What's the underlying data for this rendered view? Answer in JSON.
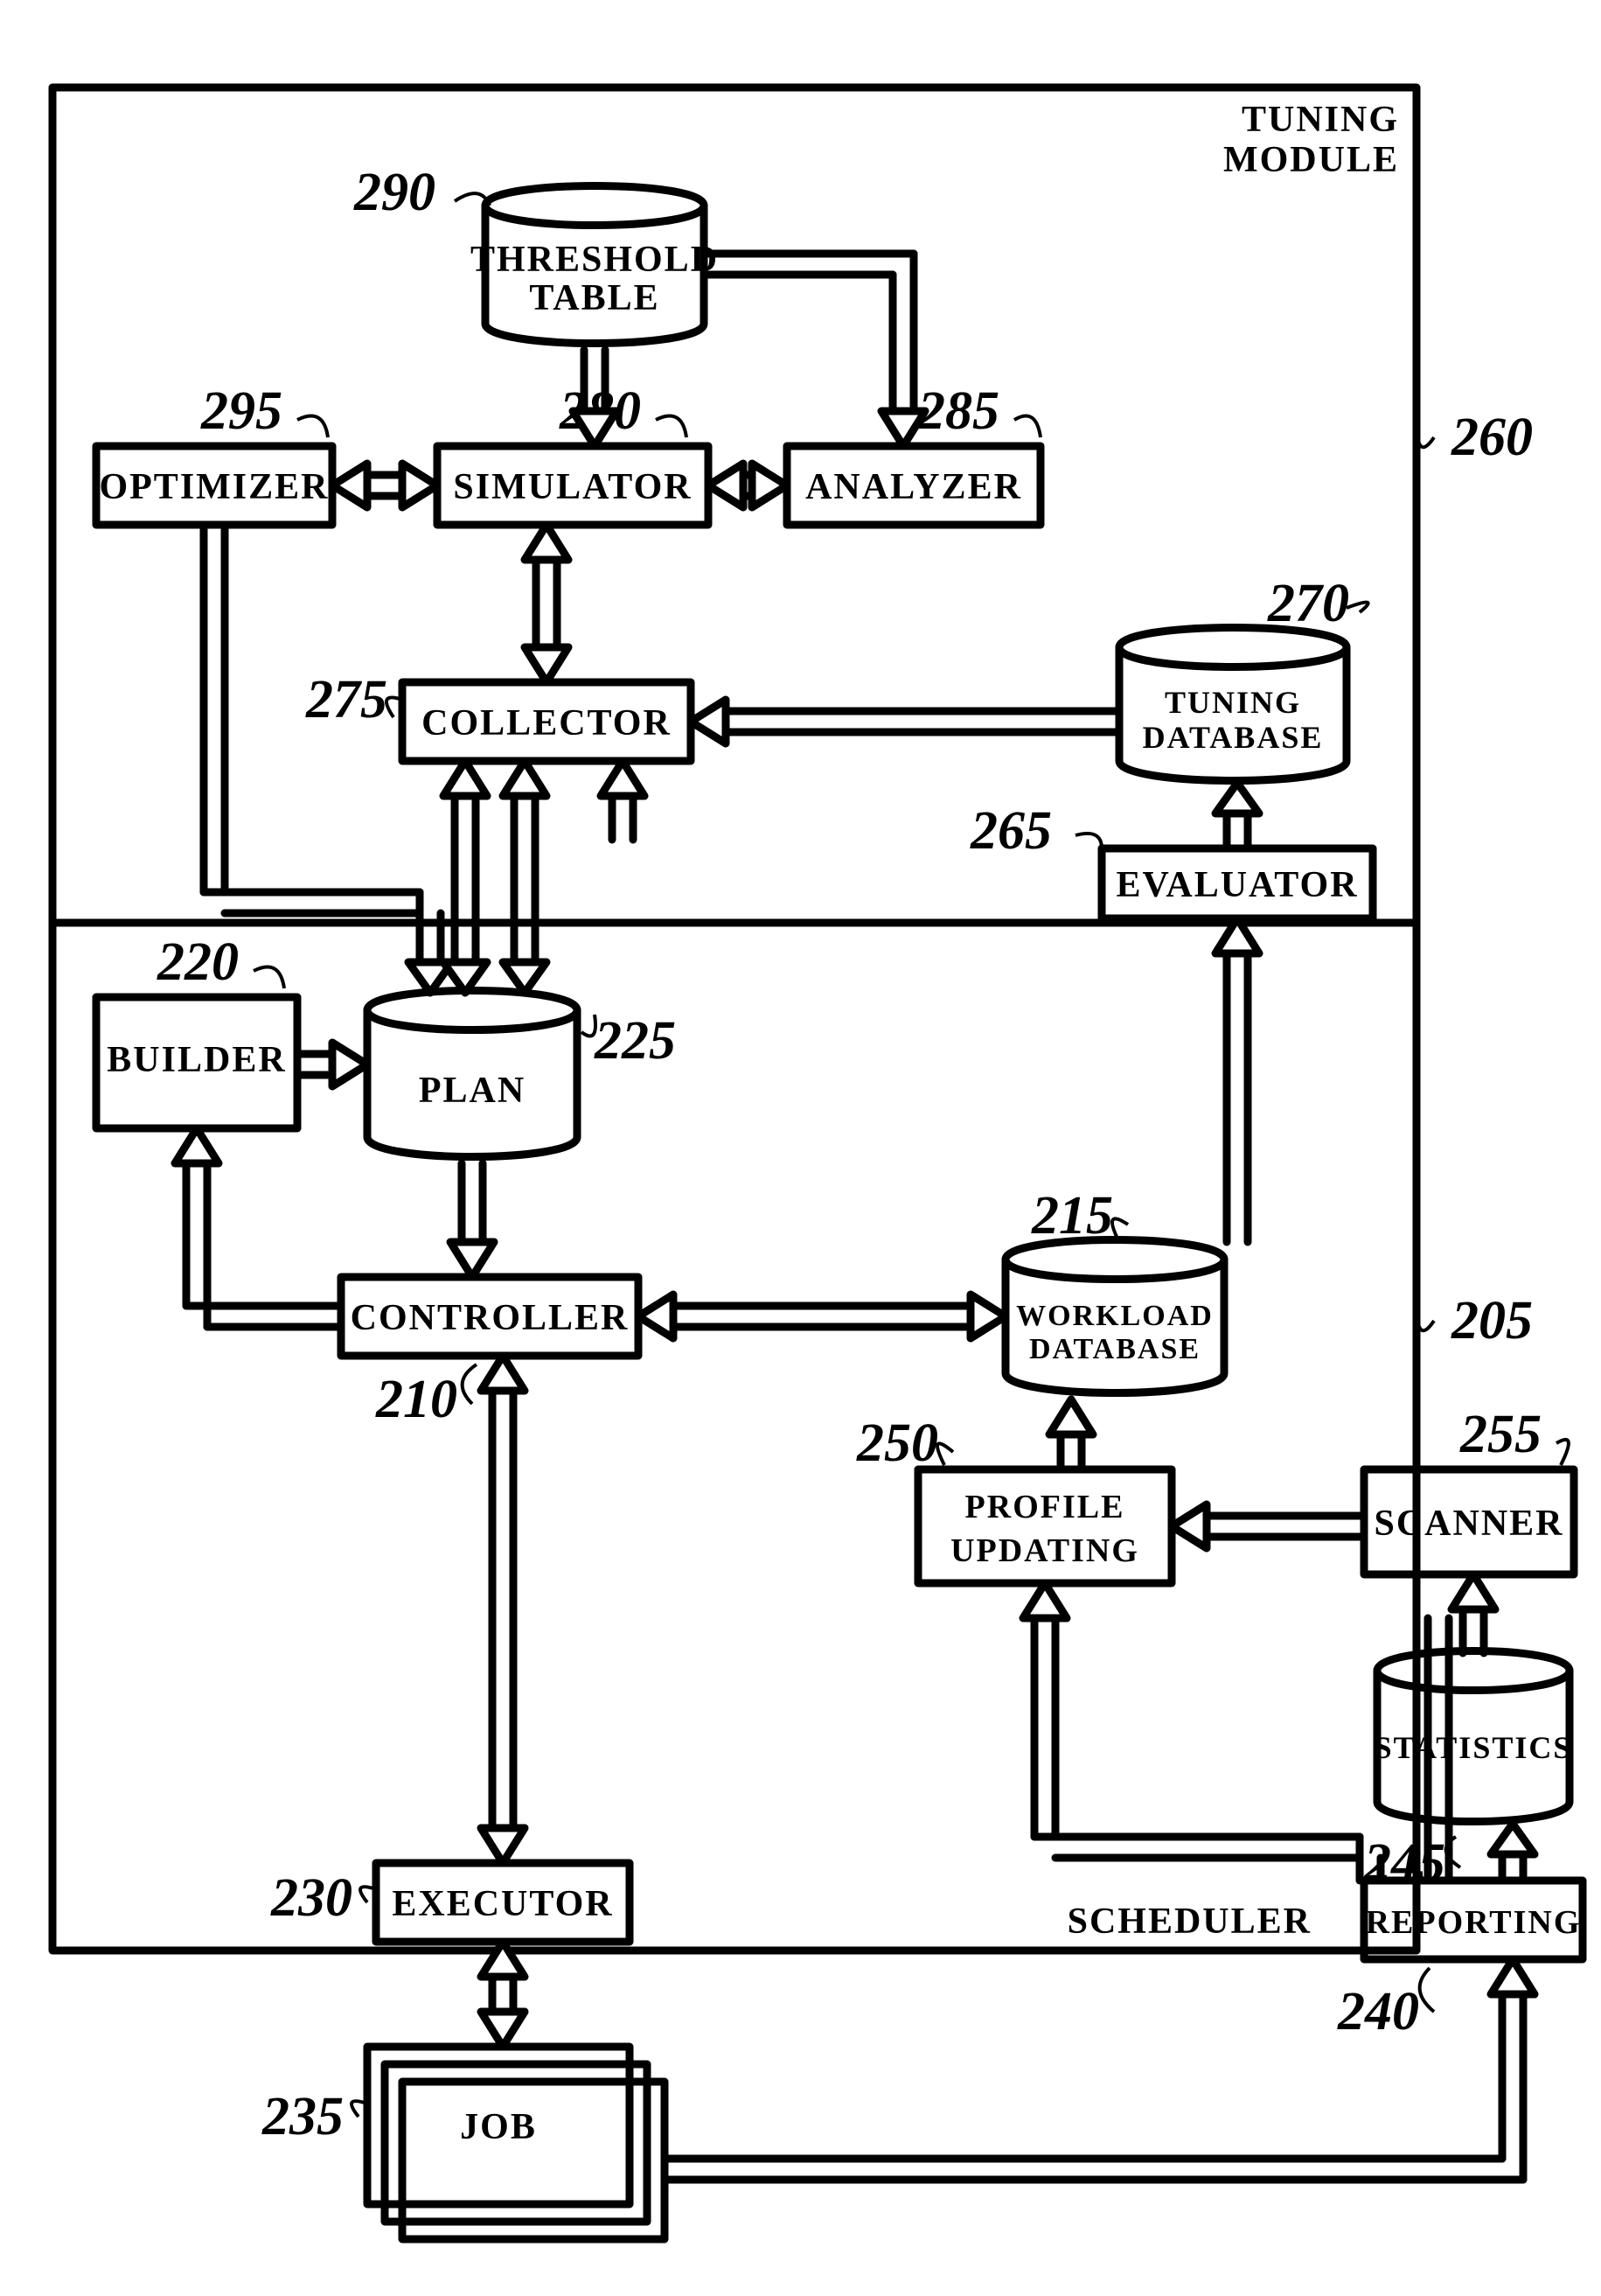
{
  "module_labels": {
    "tuning_module": "TUNING MODULE",
    "scheduler": "SCHEDULER"
  },
  "nodes": {
    "threshold_table": {
      "label": "THRESHOLD TABLE",
      "ref": "290"
    },
    "optimizer": {
      "label": "OPTIMIZER",
      "ref": "295"
    },
    "simulator": {
      "label": "SIMULATOR",
      "ref": "280"
    },
    "analyzer": {
      "label": "ANALYZER",
      "ref": "285"
    },
    "collector": {
      "label": "COLLECTOR",
      "ref": "275"
    },
    "tuning_database": {
      "label": "TUNING DATABASE",
      "ref": "270"
    },
    "evaluator": {
      "label": "EVALUATOR",
      "ref": "265"
    },
    "builder": {
      "label": "BUILDER",
      "ref": "220"
    },
    "plan": {
      "label": "PLAN",
      "ref": "225"
    },
    "controller": {
      "label": "CONTROLLER",
      "ref": "210"
    },
    "workload_database": {
      "label": "WORKLOAD DATABASE",
      "ref": "215"
    },
    "profile_updating": {
      "label": "PROFILE UPDATING",
      "ref": "250"
    },
    "scanner": {
      "label": "SCANNER",
      "ref": "255"
    },
    "statistics": {
      "label": "STATISTICS",
      "ref": "245"
    },
    "executor": {
      "label": "EXECUTOR",
      "ref": "230"
    },
    "reporting": {
      "label": "REPORTING",
      "ref": "240"
    },
    "job": {
      "label": "JOB",
      "ref": "235"
    }
  },
  "region_refs": {
    "tuning_module": "260",
    "scheduler": "205"
  }
}
